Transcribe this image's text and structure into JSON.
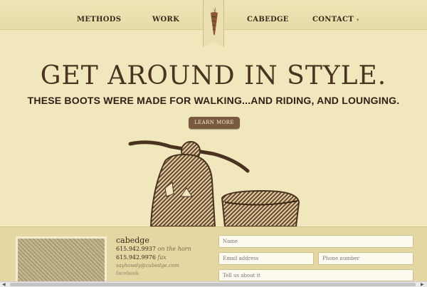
{
  "nav": {
    "items": [
      {
        "label": "METHODS"
      },
      {
        "label": "WORK"
      },
      {
        "label": "CABEDGE"
      },
      {
        "label": "CONTACT"
      }
    ],
    "contact_chevron": "▾",
    "emblem_icon": "carrot-icon"
  },
  "hero": {
    "title": "GET AROUND IN STYLE.",
    "subtitle": "THESE BOOTS WERE MADE FOR WALKING...AND RIDING, AND LOUNGING.",
    "button_label": "LEARN MORE",
    "image_icon": "scooter-illustration"
  },
  "contact": {
    "name": "cabedge",
    "phone": "615.942.9937",
    "phone_note": "on the horn",
    "fax": "615.942.9976",
    "fax_note": "fax",
    "email": "sayhowdy@cabedge.com",
    "social": "facebook"
  },
  "form": {
    "name_placeholder": "Name",
    "email_placeholder": "Email address",
    "phone_placeholder": "Phone number",
    "message_placeholder": "Tell us about it"
  },
  "colors": {
    "background": "#f1e7bd",
    "button": "#7a5a3e",
    "text": "#3a2a1c"
  }
}
